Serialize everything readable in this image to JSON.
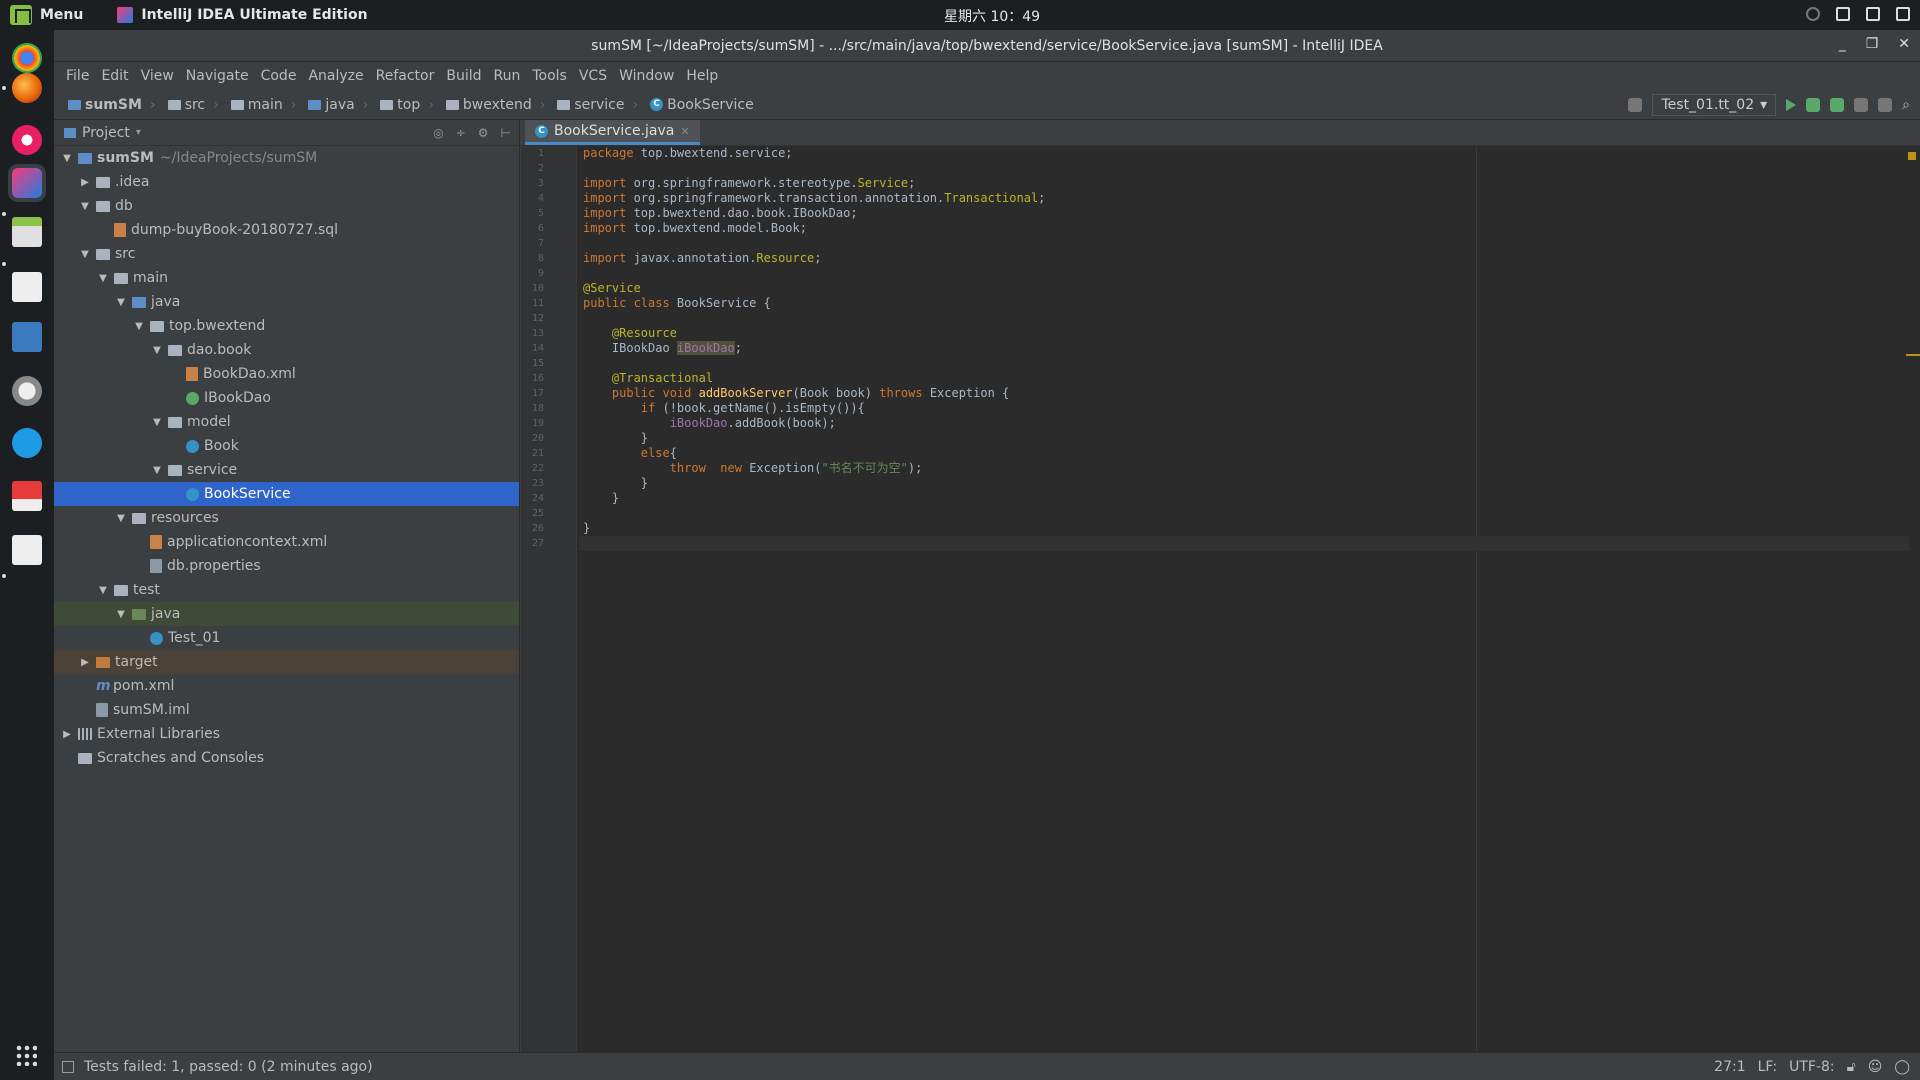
{
  "system": {
    "menu_label": "Menu",
    "active_app": "IntelliJ IDEA Ultimate Edition",
    "clock": "星期六 10：49"
  },
  "window": {
    "title": "sumSM [~/IdeaProjects/sumSM] - .../src/main/java/top/bwextend/service/BookService.java [sumSM] - IntelliJ IDEA",
    "controls": [
      "_",
      "❐",
      "✕"
    ]
  },
  "menubar": [
    "File",
    "Edit",
    "View",
    "Navigate",
    "Code",
    "Analyze",
    "Refactor",
    "Build",
    "Run",
    "Tools",
    "VCS",
    "Window",
    "Help"
  ],
  "breadcrumbs": [
    "sumSM",
    "src",
    "main",
    "java",
    "top",
    "bwextend",
    "service",
    "BookService"
  ],
  "run_config": "Test_01.tt_02",
  "project_panel": {
    "title": "Project",
    "tree": [
      {
        "label": "sumSM",
        "suffix": "~/IdeaProjects/sumSM",
        "depth": 0,
        "arrow": "▼",
        "icon": "module-folder",
        "bold": true
      },
      {
        "label": ".idea",
        "depth": 1,
        "arrow": "▶",
        "icon": "folder"
      },
      {
        "label": "db",
        "depth": 1,
        "arrow": "▼",
        "icon": "folder"
      },
      {
        "label": "dump-buyBook-20180727.sql",
        "depth": 2,
        "arrow": "",
        "icon": "sql-file"
      },
      {
        "label": "src",
        "depth": 1,
        "arrow": "▼",
        "icon": "folder"
      },
      {
        "label": "main",
        "depth": 2,
        "arrow": "▼",
        "icon": "folder"
      },
      {
        "label": "java",
        "depth": 3,
        "arrow": "▼",
        "icon": "source-folder"
      },
      {
        "label": "top.bwextend",
        "depth": 4,
        "arrow": "▼",
        "icon": "package"
      },
      {
        "label": "dao.book",
        "depth": 5,
        "arrow": "▼",
        "icon": "package"
      },
      {
        "label": "BookDao.xml",
        "depth": 6,
        "arrow": "",
        "icon": "xml-file"
      },
      {
        "label": "IBookDao",
        "depth": 6,
        "arrow": "",
        "icon": "interface"
      },
      {
        "label": "model",
        "depth": 5,
        "arrow": "▼",
        "icon": "package"
      },
      {
        "label": "Book",
        "depth": 6,
        "arrow": "",
        "icon": "class"
      },
      {
        "label": "service",
        "depth": 5,
        "arrow": "▼",
        "icon": "package"
      },
      {
        "label": "BookService",
        "depth": 6,
        "arrow": "",
        "icon": "class",
        "selected": true
      },
      {
        "label": "resources",
        "depth": 3,
        "arrow": "▼",
        "icon": "resources-folder"
      },
      {
        "label": "applicationcontext.xml",
        "depth": 4,
        "arrow": "",
        "icon": "xml-file"
      },
      {
        "label": "db.properties",
        "depth": 4,
        "arrow": "",
        "icon": "properties-file"
      },
      {
        "label": "test",
        "depth": 2,
        "arrow": "▼",
        "icon": "folder"
      },
      {
        "label": "java",
        "depth": 3,
        "arrow": "▼",
        "icon": "test-folder",
        "test": true
      },
      {
        "label": "Test_01",
        "depth": 4,
        "arrow": "",
        "icon": "class"
      },
      {
        "label": "target",
        "depth": 1,
        "arrow": "▶",
        "icon": "excluded-folder",
        "target": true
      },
      {
        "label": "pom.xml",
        "depth": 1,
        "arrow": "",
        "icon": "maven-file"
      },
      {
        "label": "sumSM.iml",
        "depth": 1,
        "arrow": "",
        "icon": "iml-file"
      },
      {
        "label": "External Libraries",
        "depth": 0,
        "arrow": "▶",
        "icon": "library"
      },
      {
        "label": "Scratches and Consoles",
        "depth": 0,
        "arrow": "",
        "icon": "scratch"
      }
    ]
  },
  "editor": {
    "tab_label": "BookService.java",
    "code_lines": [
      [
        [
          "kw",
          "package "
        ],
        [
          "",
          "top.bwextend.service;"
        ]
      ],
      [],
      [
        [
          "kw",
          "import "
        ],
        [
          "",
          "org.springframework.stereotype."
        ],
        [
          "an",
          "Service"
        ],
        [
          "",
          ";"
        ]
      ],
      [
        [
          "kw",
          "import "
        ],
        [
          "",
          "org.springframework.transaction.annotation."
        ],
        [
          "an",
          "Transactional"
        ],
        [
          "",
          ";"
        ]
      ],
      [
        [
          "kw",
          "import "
        ],
        [
          "",
          "top.bwextend.dao.book.IBookDao;"
        ]
      ],
      [
        [
          "kw",
          "import "
        ],
        [
          "",
          "top.bwextend.model.Book;"
        ]
      ],
      [],
      [
        [
          "kw",
          "import "
        ],
        [
          "",
          "javax.annotation."
        ],
        [
          "an",
          "Resource"
        ],
        [
          "",
          ";"
        ]
      ],
      [],
      [
        [
          "an",
          "@Service"
        ]
      ],
      [
        [
          "kw",
          "public class "
        ],
        [
          "",
          "BookService {"
        ]
      ],
      [],
      [
        [
          "",
          "    "
        ],
        [
          "an",
          "@Resource"
        ]
      ],
      [
        [
          "",
          "    IBookDao "
        ],
        [
          "fd hl",
          "iBookDao"
        ],
        [
          "",
          ";"
        ]
      ],
      [],
      [
        [
          "",
          "    "
        ],
        [
          "an",
          "@Transactional"
        ]
      ],
      [
        [
          "",
          "    "
        ],
        [
          "kw",
          "public void "
        ],
        [
          "fn",
          "addBookServer"
        ],
        [
          "",
          "(Book book) "
        ],
        [
          "kw",
          "throws "
        ],
        [
          "",
          "Exception {"
        ]
      ],
      [
        [
          "",
          "        "
        ],
        [
          "kw",
          "if "
        ],
        [
          "",
          "(!book.getName().isEmpty()){"
        ]
      ],
      [
        [
          "",
          "            "
        ],
        [
          "fd",
          "iBookDao"
        ],
        [
          "",
          ".addBook(book);"
        ]
      ],
      [
        [
          "",
          "        }"
        ]
      ],
      [
        [
          "",
          "        "
        ],
        [
          "kw",
          "else"
        ],
        [
          "",
          "{"
        ]
      ],
      [
        [
          "",
          "            "
        ],
        [
          "kw",
          "throw  new "
        ],
        [
          "",
          "Exception("
        ],
        [
          "st",
          "\"书名不可为空\""
        ],
        [
          "",
          ");"
        ]
      ],
      [
        [
          "",
          "        }"
        ]
      ],
      [
        [
          "",
          "    }"
        ]
      ],
      [],
      [
        [
          "",
          "}"
        ]
      ],
      []
    ],
    "current_line": 27
  },
  "status": {
    "message": "Tests failed: 1, passed: 0 (2 minutes ago)",
    "position": "27:1",
    "line_sep": "LF:",
    "encoding": "UTF-8:"
  }
}
